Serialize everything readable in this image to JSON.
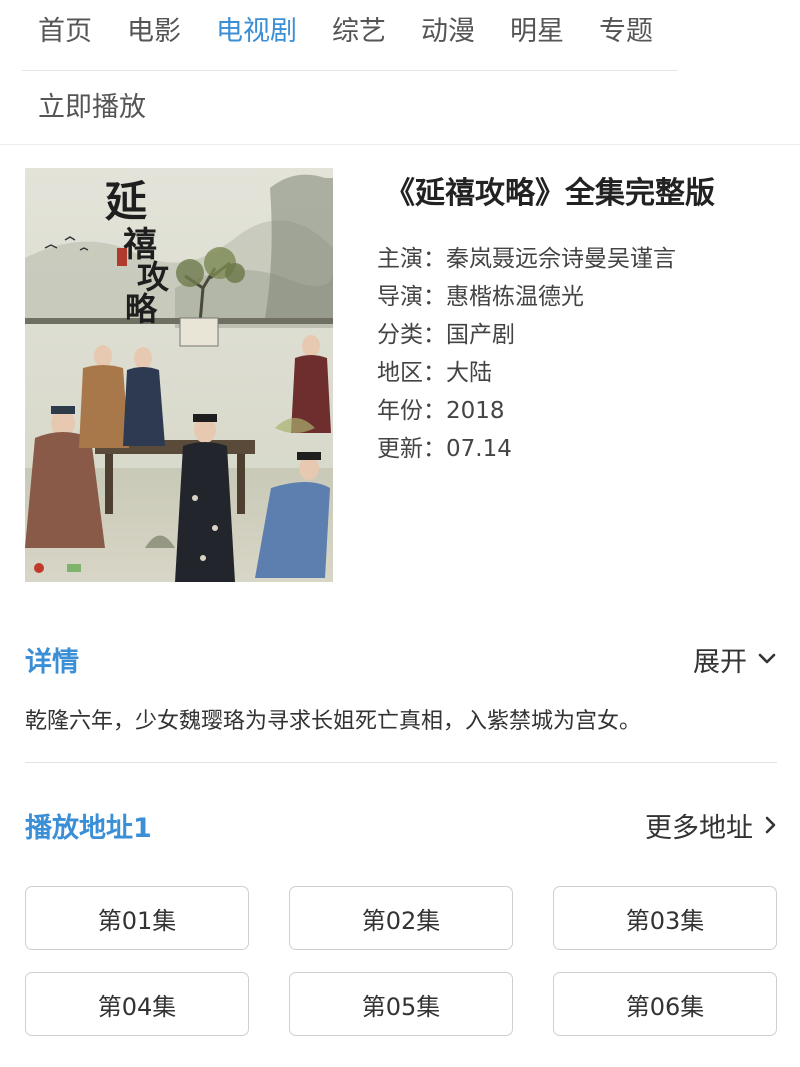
{
  "nav": {
    "items": [
      {
        "label": "首页",
        "active": false
      },
      {
        "label": "电影",
        "active": false
      },
      {
        "label": "电视剧",
        "active": true
      },
      {
        "label": "综艺",
        "active": false
      },
      {
        "label": "动漫",
        "active": false
      },
      {
        "label": "明星",
        "active": false
      },
      {
        "label": "专题",
        "active": false
      }
    ],
    "play_now": "立即播放"
  },
  "show": {
    "title": "《延禧攻略》全集完整版",
    "poster_title_art": "延禧攻略",
    "meta": [
      {
        "label": "主演：",
        "value": "秦岚聂远佘诗曼吴谨言"
      },
      {
        "label": "导演：",
        "value": "惠楷栋温德光"
      },
      {
        "label": "分类：",
        "value": "国产剧"
      },
      {
        "label": "地区：",
        "value": "大陆"
      },
      {
        "label": "年份：",
        "value": "2018"
      },
      {
        "label": "更新：",
        "value": "07.14"
      }
    ]
  },
  "details": {
    "heading": "详情",
    "expand_label": "展开",
    "text": "乾隆六年，少女魏璎珞为寻求长姐死亡真相，入紫禁城为宫女。"
  },
  "play": {
    "heading": "播放地址1",
    "more_label": "更多地址",
    "episodes": [
      "第01集",
      "第02集",
      "第03集",
      "第04集",
      "第05集",
      "第06集"
    ]
  },
  "colors": {
    "accent": "#3b8fd6",
    "text": "#333333",
    "border": "#cfcfcf"
  },
  "icons": {
    "expand": "chevron-down-icon",
    "more": "chevron-right-icon"
  }
}
